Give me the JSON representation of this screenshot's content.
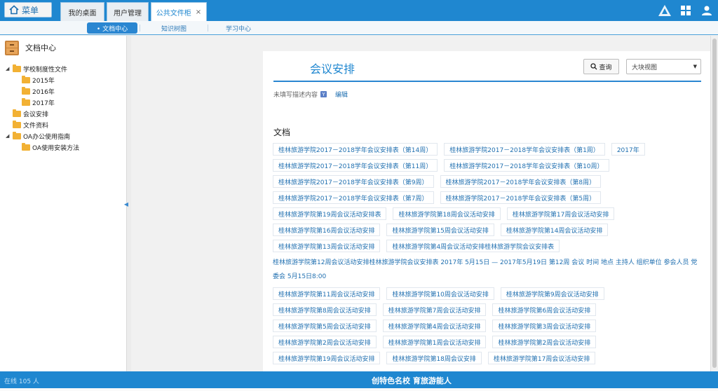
{
  "topbar": {
    "menu_label": "菜单",
    "tabs": [
      {
        "label": "我的桌面"
      },
      {
        "label": "用户管理"
      },
      {
        "label": "公共文件柜",
        "close": "×"
      }
    ],
    "icons": [
      "announcement-icon",
      "grid-icon",
      "user-icon"
    ]
  },
  "subnav": {
    "items": [
      {
        "label": "• 文档中心"
      },
      {
        "label": "知识树图"
      },
      {
        "label": "学习中心"
      }
    ]
  },
  "sidebar": {
    "title": "文档中心",
    "tree": [
      {
        "label": "学校制度性文件",
        "expanded": true,
        "level": 0
      },
      {
        "label": "2015年",
        "level": 1
      },
      {
        "label": "2016年",
        "level": 1
      },
      {
        "label": "2017年",
        "level": 1
      },
      {
        "label": "会议安排",
        "level": 0
      },
      {
        "label": "文件资料",
        "level": 0
      },
      {
        "label": "OA办公使用指南",
        "expanded": true,
        "level": 0
      },
      {
        "label": "OA使用安装方法",
        "level": 1
      }
    ]
  },
  "main": {
    "title": "会议安排",
    "query_label": "查询",
    "view_select": "大块视图",
    "desc": "未填写描述内容",
    "desc_icon": "Y",
    "edit_label": "编辑",
    "section": "文档",
    "docs": [
      "桂林旅游学院2017－2018学年会议安排表（第14周）",
      "桂林旅游学院2017－2018学年会议安排表（第1周）",
      "2017年",
      "桂林旅游学院2017－2018学年会议安排表（第11周）",
      "桂林旅游学院2017－2018学年会议安排表（第10周）",
      "桂林旅游学院2017－2018学年会议安排表（第9周）",
      "桂林旅游学院2017－2018学年会议安排表（第8周）",
      "桂林旅游学院2017－2018学年会议安排表（第7周）",
      "桂林旅游学院2017－2018学年会议安排表（第5周）",
      "桂林旅游学院第19周会议活动安排表",
      "桂林旅游学院第18周会议活动安排",
      "桂林旅游学院第17周会议活动安排",
      "桂林旅游学院第16周会议活动安排",
      "桂林旅游学院第15周会议活动安排",
      "桂林旅游学院第14周会议活动安排",
      "桂林旅游学院第13周会议活动安排",
      "桂林旅游学院第4周会议活动安排桂林旅游学院会议安排表",
      "桂林旅游学院第12周会议活动安排桂林旅游学院会议安排表 2017年 5月15日 — 2017年5月19日 第12周 会议 时间 地点 主持人 组织单位 参会人员 党委会 5月15日8:00",
      "桂林旅游学院第11周会议活动安排",
      "桂林旅游学院第10周会议活动安排",
      "桂林旅游学院第9周会议活动安排",
      "桂林旅游学院第8周会议活动安排",
      "桂林旅游学院第7周会议活动安排",
      "桂林旅游学院第6周会议活动安排",
      "桂林旅游学院第5周会议活动安排",
      "桂林旅游学院第4周会议活动安排",
      "桂林旅游学院第3周会议活动安排",
      "桂林旅游学院第2周会议活动安排",
      "桂林旅游学院第1周会议活动安排",
      "桂林旅游学院第2周会议活动安排",
      "桂林旅游学院第19周会议活动安排",
      "桂林旅游学院第18周会议安排",
      "桂林旅游学院第17周会议活动安排"
    ]
  },
  "footer": {
    "online": "在线 105 人",
    "slogan": "创特色名校 育旅游能人"
  },
  "colors": {
    "primary": "#1f87d0",
    "link": "#1f6fb0",
    "folder": "#f2b134"
  }
}
